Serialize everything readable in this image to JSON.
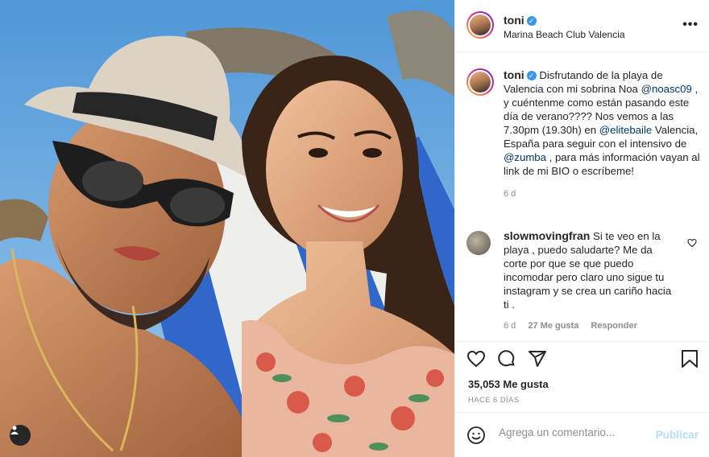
{
  "post": {
    "user": {
      "username": "toni",
      "verified": true,
      "location": "Marina Beach Club Valencia"
    },
    "caption": {
      "username": "toni",
      "parts": [
        {
          "text": "Disfrutando de la playa de Valencia con mi sobrina Noa ",
          "mention": false
        },
        {
          "text": "@noasc09",
          "mention": true
        },
        {
          "text": " , y cuéntenme como están pasando este día de verano???? Nos vemos a las 7.30pm (19.30h) en ",
          "mention": false
        },
        {
          "text": "@elitebaile",
          "mention": true
        },
        {
          "text": " Valencia, España para seguir con el intensivo de ",
          "mention": false
        },
        {
          "text": "@zumba",
          "mention": true
        },
        {
          "text": " , para más información vayan al link de mi BIO o escríbeme!",
          "mention": false
        }
      ],
      "time": "6 d"
    },
    "comments": [
      {
        "username": "slowmovingfran",
        "text": "Si te veo en la playa , puedo saludarte? Me da corte por que se que puedo incomodar pero claro uno sigue tu instagram y se crea un cariño hacia ti .",
        "time": "6 d",
        "likes": "27 Me gusta",
        "reply": "Responder"
      }
    ],
    "likes_label": "35,053 Me gusta",
    "date_label": "HACE 6 DÍAS",
    "add_comment": {
      "placeholder": "Agrega un comentario...",
      "publish_label": "Publicar"
    },
    "icons": {
      "more": "more-options-icon",
      "like": "heart-icon",
      "comment": "comment-icon",
      "share": "share-icon",
      "save": "bookmark-icon",
      "emoji": "emoji-icon",
      "tag": "user-tag-icon"
    },
    "colors": {
      "accent": "#0095f6",
      "mention": "#00376b",
      "muted": "#8e8e8e",
      "verified": "#3897f0"
    }
  }
}
